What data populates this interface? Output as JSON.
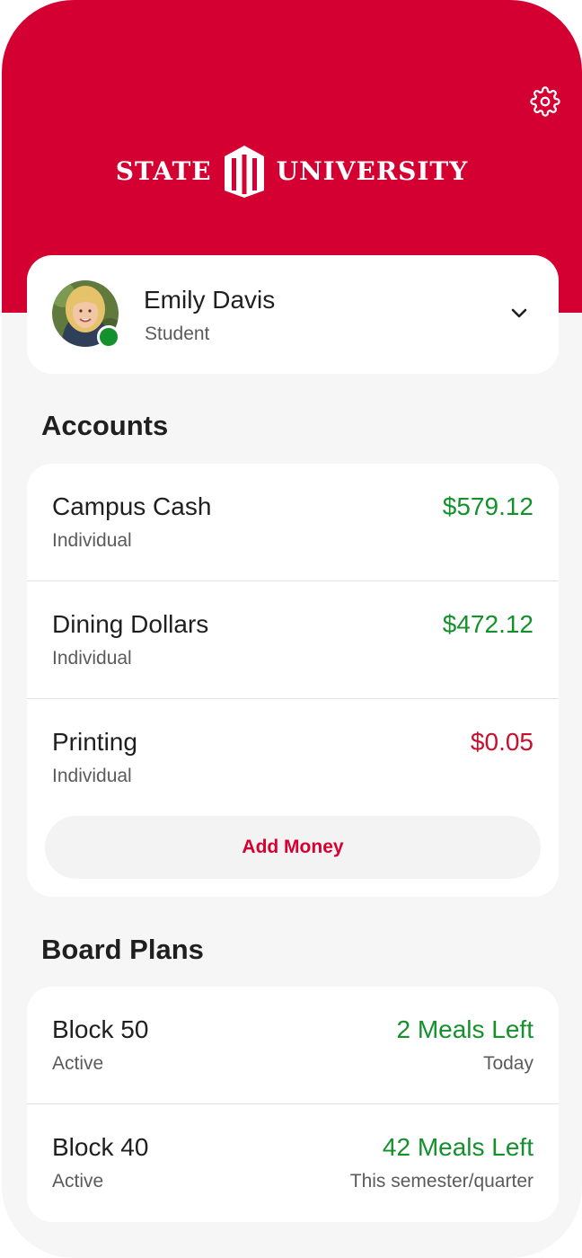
{
  "header": {
    "logo_left": "STATE",
    "logo_right": "UNIVERSITY",
    "settings_icon": "gear-icon",
    "brand_color": "#d50032"
  },
  "profile": {
    "name": "Emily Davis",
    "role": "Student",
    "status_color": "#14912c",
    "expand_icon": "chevron-down-icon"
  },
  "accounts": {
    "title": "Accounts",
    "items": [
      {
        "name": "Campus Cash",
        "type": "Individual",
        "balance": "$579.12",
        "status": "positive"
      },
      {
        "name": "Dining Dollars",
        "type": "Individual",
        "balance": "$472.12",
        "status": "positive"
      },
      {
        "name": "Printing",
        "type": "Individual",
        "balance": "$0.05",
        "status": "low"
      }
    ],
    "add_money_label": "Add Money"
  },
  "board_plans": {
    "title": "Board Plans",
    "items": [
      {
        "name": "Block 50",
        "status": "Active",
        "meals": "2 Meals Left",
        "period": "Today"
      },
      {
        "name": "Block 40",
        "status": "Active",
        "meals": "42 Meals Left",
        "period": "This semester/quarter"
      }
    ]
  },
  "colors": {
    "positive": "#14912c",
    "low": "#c8102e"
  }
}
